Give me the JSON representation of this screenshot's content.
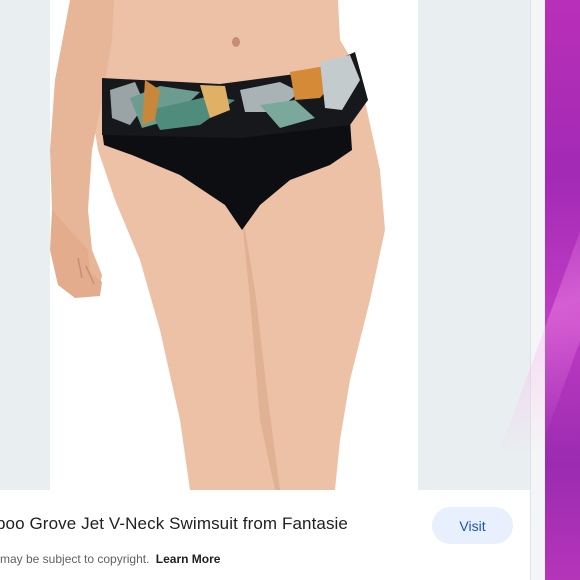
{
  "product": {
    "title": "boo Grove Jet V-Neck Swimsuit from Fantasie",
    "visit_label": "Visit",
    "copyright_text": "may be subject to copyright.",
    "learn_more_label": "Learn More"
  },
  "image": {
    "subject": "swimwear-bikini-bottom-photo"
  },
  "colors": {
    "viewer_bg": "#e9eef0",
    "visit_bg": "#e8f0fe",
    "visit_text": "#1a56b3",
    "desktop": "#b92fb8"
  }
}
